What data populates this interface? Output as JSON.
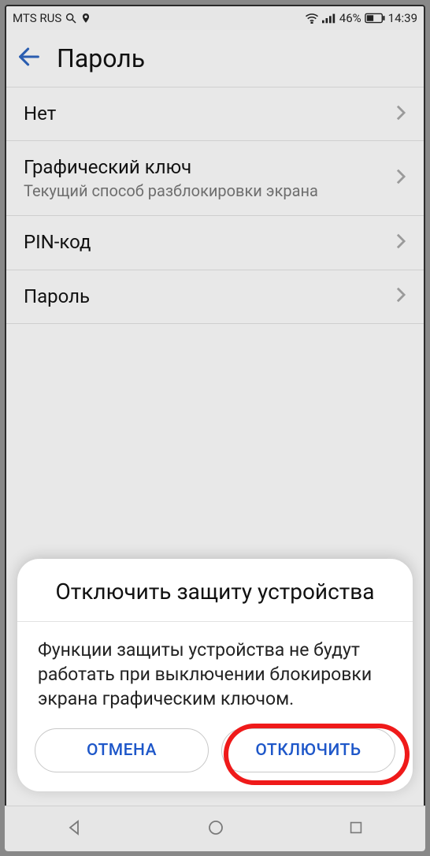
{
  "statusbar": {
    "carrier": "MTS RUS",
    "battery_pct": "46%",
    "time": "14:39"
  },
  "header": {
    "title": "Пароль"
  },
  "options": [
    {
      "label": "Нет",
      "sub": ""
    },
    {
      "label": "Графический ключ",
      "sub": "Текущий способ разблокировки экрана"
    },
    {
      "label": "PIN-код",
      "sub": ""
    },
    {
      "label": "Пароль",
      "sub": ""
    }
  ],
  "dialog": {
    "title": "Отключить защиту устройства",
    "body": "Функции защиты устройства не будут работать при выключении блокировки экрана графическим ключом.",
    "cancel": "ОТМЕНА",
    "confirm": "ОТКЛЮЧИТЬ"
  }
}
